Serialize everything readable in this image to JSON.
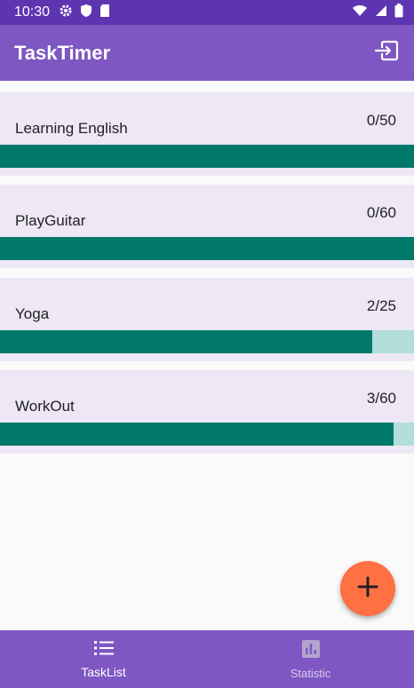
{
  "status_bar": {
    "time": "10:30"
  },
  "app_bar": {
    "title": "TaskTimer",
    "action_icon": "logout-icon"
  },
  "tasks": [
    {
      "name": "Learning English",
      "count": "0/50",
      "progress": 1.0
    },
    {
      "name": "PlayGuitar",
      "count": "0/60",
      "progress": 1.0
    },
    {
      "name": "Yoga",
      "count": "2/25",
      "progress": 0.9
    },
    {
      "name": "WorkOut",
      "count": "3/60",
      "progress": 0.95
    }
  ],
  "fab": {
    "icon": "plus-icon"
  },
  "bottom_nav": {
    "items": [
      {
        "label": "TaskList",
        "icon": "list-icon",
        "active": true
      },
      {
        "label": "Statistic",
        "icon": "bar-chart-icon",
        "active": false
      }
    ]
  },
  "colors": {
    "status_bar": "#5e35b1",
    "app_bar": "#7e57c2",
    "card_bg": "#ede7f6",
    "progress_fill": "#00796b",
    "progress_track": "#b2dfdb",
    "fab": "#ff7043"
  }
}
